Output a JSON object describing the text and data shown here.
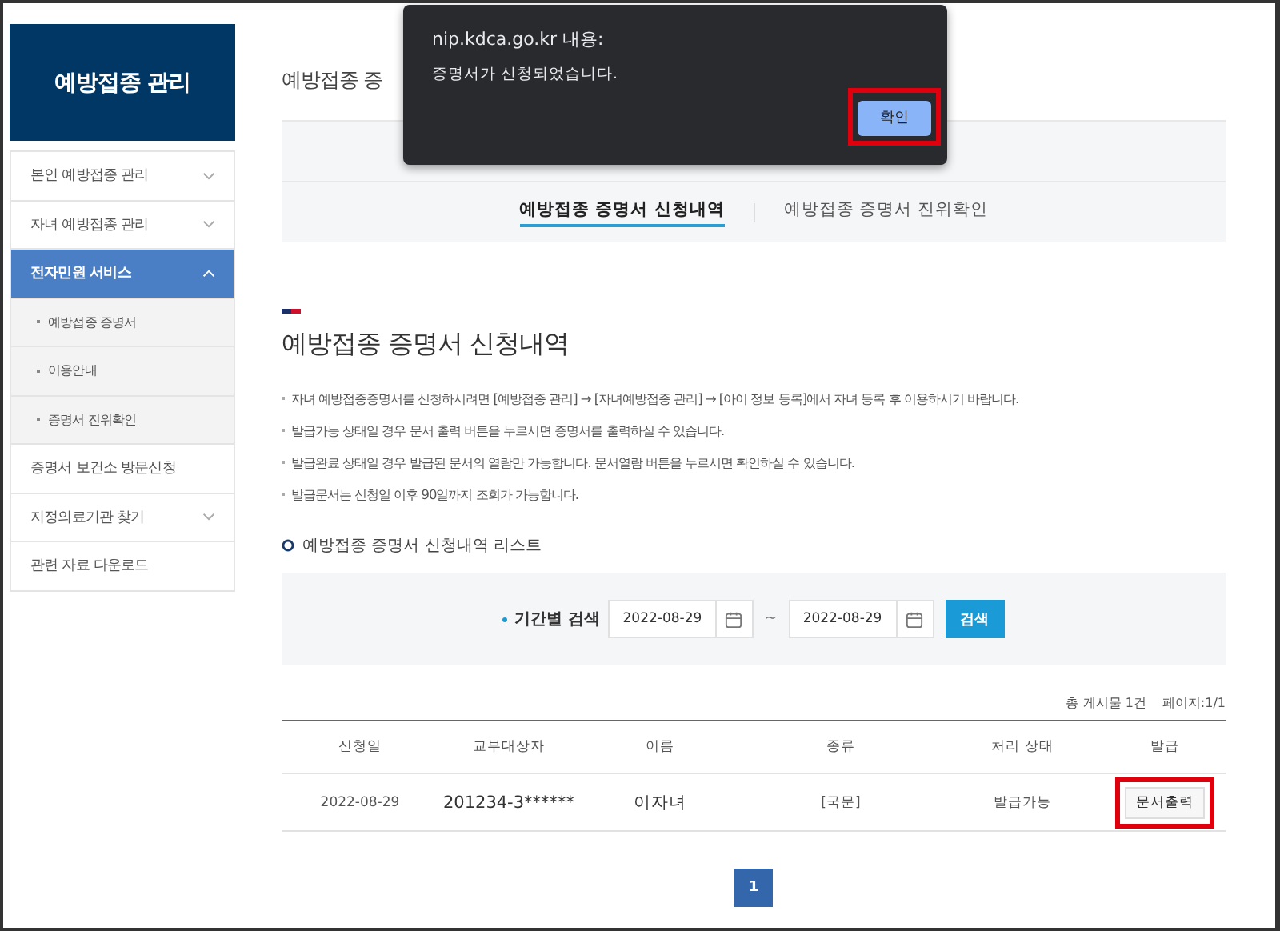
{
  "sidebar": {
    "title": "예방접종 관리",
    "items": [
      {
        "label": "본인 예방접종 관리",
        "kind": "menu",
        "selected": false,
        "expanded": false
      },
      {
        "label": "자녀 예방접종 관리",
        "kind": "menu",
        "selected": false,
        "expanded": false
      },
      {
        "label": "전자민원 서비스",
        "kind": "menu",
        "selected": true,
        "expanded": true
      },
      {
        "label": "예방접종 증명서",
        "kind": "sub",
        "selected": false
      },
      {
        "label": "이용안내",
        "kind": "sub",
        "selected": false
      },
      {
        "label": "증명서 진위확인",
        "kind": "sub",
        "selected": false
      },
      {
        "label": "증명서 보건소 방문신청",
        "kind": "menu",
        "selected": false
      },
      {
        "label": "지정의료기관 찾기",
        "kind": "menu",
        "selected": false,
        "expanded": false
      },
      {
        "label": "관련 자료 다운로드",
        "kind": "menu",
        "selected": false
      }
    ]
  },
  "page_title": "예방접종 증",
  "tabs": [
    {
      "label": "예방접종 증명서 신청내역",
      "selected": true
    },
    {
      "label": "예방접종 증명서 진위확인",
      "selected": false
    }
  ],
  "section_title": "예방접종 증명서 신청내역",
  "notes": [
    "자녀 예방접종증명서를 신청하시려면 [예방접종 관리] → [자녀예방접종 관리] → [아이 정보 등록]에서 자녀 등록 후 이용하시기 바랍니다.",
    "발급가능 상태일 경우 문서 출력 버튼을 누르시면 증명서를 출력하실 수 있습니다.",
    "발급완료 상태일 경우 발급된 문서의 열람만 가능합니다. 문서열람 버튼을 누르시면 확인하실 수 있습니다.",
    "발급문서는 신청일 이후 90일까지 조회가 가능합니다."
  ],
  "list_title": "예방접종 증명서 신청내역 리스트",
  "search": {
    "label": "기간별 검색",
    "from": "2022-08-29",
    "separator": "~",
    "to": "2022-08-29",
    "button": "검색"
  },
  "summary": {
    "total": "총 게시물 1건",
    "page": "페이지:1/1"
  },
  "table": {
    "columns": [
      "신청일",
      "교부대상자",
      "이름",
      "종류",
      "처리 상태",
      "발급"
    ],
    "rows": [
      {
        "cells": [
          "2022-08-29",
          "201234-3******",
          "이자녀",
          "[국문]",
          "발급가능"
        ],
        "action": "문서출력",
        "highlighted": true
      }
    ]
  },
  "pagination": [
    {
      "label": "1",
      "selected": true
    }
  ],
  "dialog": {
    "title": "nip.kdca.go.kr 내용:",
    "message": "증명서가 신청되었습니다.",
    "button": "확인",
    "highlighted": true
  }
}
